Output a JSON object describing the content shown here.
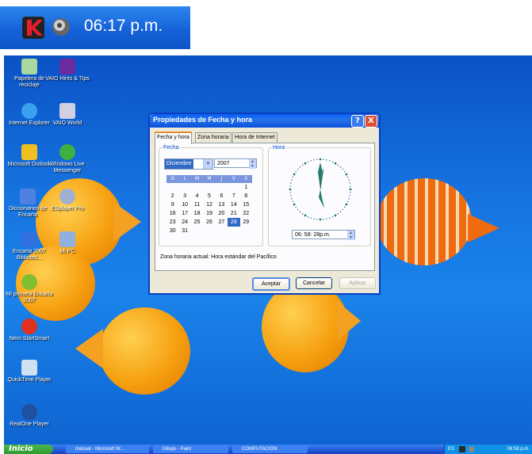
{
  "tray_zoom": {
    "time": "06:17 p.m."
  },
  "desktop_icons": [
    {
      "label": "Papelera de reciclaje"
    },
    {
      "label": "VAIO Hints & Tips"
    },
    {
      "label": "Internet Explorer"
    },
    {
      "label": "VAIO World"
    },
    {
      "label": "Microsoft Outlook"
    },
    {
      "label": "Windows Live Messenger"
    },
    {
      "label": "Diccionarios de Encarta"
    },
    {
      "label": "ESplayer Pro"
    },
    {
      "label": "Encarta 2007 Bibliotec..."
    },
    {
      "label": "Mi PC"
    },
    {
      "label": "Mi primera Encarta 2007"
    },
    {
      "label": "Nero StartSmart"
    },
    {
      "label": "QuickTime Player"
    },
    {
      "label": "RealOne Player"
    }
  ],
  "dialog": {
    "title": "Propiedades de Fecha y hora",
    "help_btn": "?",
    "close_btn": "X",
    "tabs": [
      "Fecha y hora",
      "Zona horaria",
      "Hora de Internet"
    ],
    "fecha_label": "Fecha",
    "hora_label": "Hora",
    "month": "Diciembre",
    "year": "2007",
    "weekdays": [
      "D",
      "L",
      "M",
      "M",
      "J",
      "V",
      "S"
    ],
    "weeks": [
      [
        "",
        "",
        "",
        "",
        "",
        "",
        "1"
      ],
      [
        "2",
        "3",
        "4",
        "5",
        "6",
        "7",
        "8"
      ],
      [
        "9",
        "10",
        "11",
        "12",
        "13",
        "14",
        "15"
      ],
      [
        "16",
        "17",
        "18",
        "19",
        "20",
        "21",
        "22"
      ],
      [
        "23",
        "24",
        "25",
        "26",
        "27",
        "28",
        "29"
      ],
      [
        "30",
        "31",
        "",
        "",
        "",
        "",
        ""
      ]
    ],
    "selected_day": "28",
    "time_value": "06: 58: 28p.m.",
    "timezone_text": "Zona horaria actual:  Hora estándar del Pacífico",
    "ok": "Aceptar",
    "cancel": "Cancelar",
    "apply": "Aplicar"
  },
  "taskbar": {
    "start": "Inicio",
    "tasks": [
      "manual - Microsoft W...",
      "Dibujo - Paint",
      "COMPUTACIÓN"
    ],
    "lang": "ES",
    "clock": "06:58 p.m."
  },
  "colors": {
    "desktop_blue": "#1673e0",
    "taskbar_blue": "#245edb",
    "start_green": "#2f9a2f",
    "fish_orange": "#f6a010"
  },
  "icons": [
    "kaspersky-icon",
    "speaker-icon",
    "recycle-bin-icon",
    "vaio-icon",
    "ie-icon",
    "outlook-icon",
    "messenger-icon",
    "encarta-icon",
    "esplayer-icon",
    "my-computer-icon",
    "nero-icon",
    "quicktime-icon",
    "realone-icon"
  ]
}
